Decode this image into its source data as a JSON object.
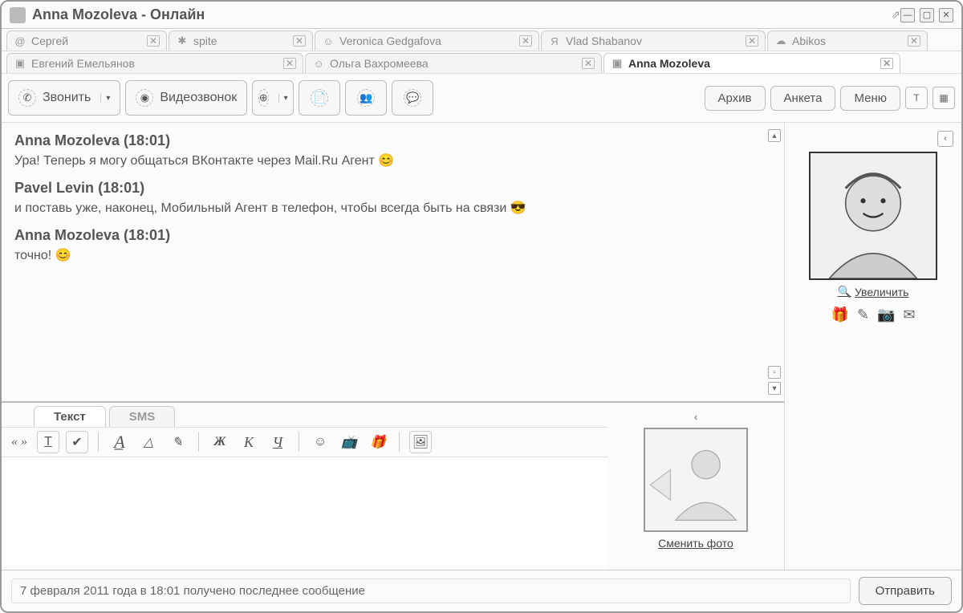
{
  "window": {
    "title": "Anna Mozoleva - Онлайн"
  },
  "tabs_row1": [
    {
      "icon": "@",
      "label": "Сергей"
    },
    {
      "icon": "✱",
      "label": "spite"
    },
    {
      "icon": "☺",
      "label": "Veronica Gedgafova"
    },
    {
      "icon": "Я",
      "label": "Vlad Shabanov"
    },
    {
      "icon": "☁",
      "label": "Abikos"
    }
  ],
  "tabs_row2": [
    {
      "icon": "▣",
      "label": "Евгений Емельянов"
    },
    {
      "icon": "☺",
      "label": "Ольга Вахромеева"
    },
    {
      "icon": "▣",
      "label": "Anna Mozoleva",
      "active": true
    }
  ],
  "toolbar": {
    "call": "Звонить",
    "videocall": "Видеозвонок",
    "archive": "Архив",
    "profile": "Анкета",
    "menu": "Меню"
  },
  "messages": [
    {
      "author": "Anna Mozoleva",
      "time": "18:01",
      "text": "Ура!  Теперь я могу общаться ВКонтакте через Mail.Ru Агент",
      "emoji": "😊"
    },
    {
      "author": "Pavel Levin",
      "time": "18:01",
      "text": "и поставь уже, наконец, Мобильный Агент в телефон, чтобы всегда быть на связи",
      "emoji": "😎"
    },
    {
      "author": "Anna Mozoleva",
      "time": "18:01",
      "text": "точно!",
      "emoji": "😊"
    }
  ],
  "side": {
    "zoom": "Увеличить",
    "change_photo": "Сменить фото"
  },
  "input_tabs": {
    "text": "Текст",
    "sms": "SMS"
  },
  "format": {
    "quote": "« »",
    "bold": "Ж",
    "italic": "К",
    "underline": "Ч"
  },
  "footer": {
    "status": "7 февраля 2011 года в 18:01 получено последнее сообщение",
    "send": "Отправить"
  }
}
